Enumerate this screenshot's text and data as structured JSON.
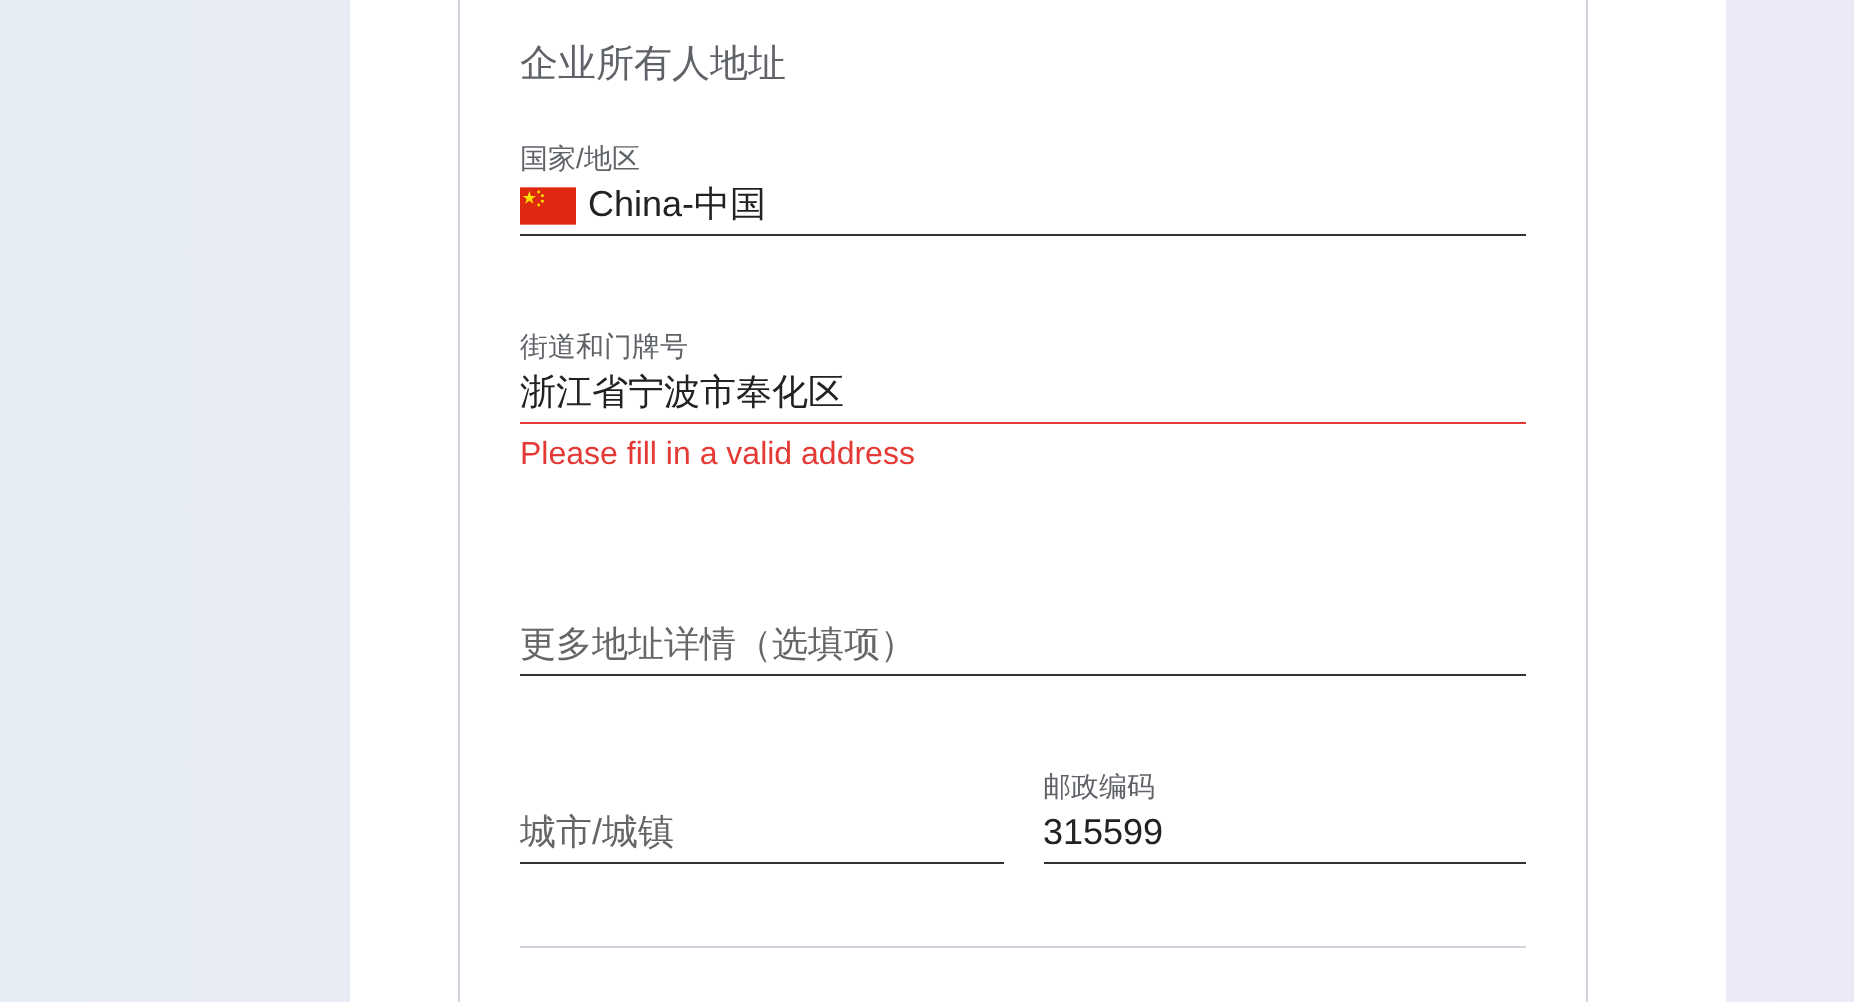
{
  "section_title": "企业所有人地址",
  "fields": [
    {
      "label": "国家/地区",
      "value": "China-中国",
      "flag": true,
      "invalid": false
    },
    {
      "label": "街道和门牌号",
      "value": "浙江省宁波市奉化区",
      "invalid": true,
      "error": "Please fill in a valid address"
    },
    {
      "placeholder": "更多地址详情（选填项）",
      "invalid": false
    }
  ],
  "row_fields": [
    {
      "placeholder": "城市/城镇",
      "invalid": false
    },
    {
      "label": "邮政编码",
      "value": "315599",
      "invalid": false
    }
  ]
}
